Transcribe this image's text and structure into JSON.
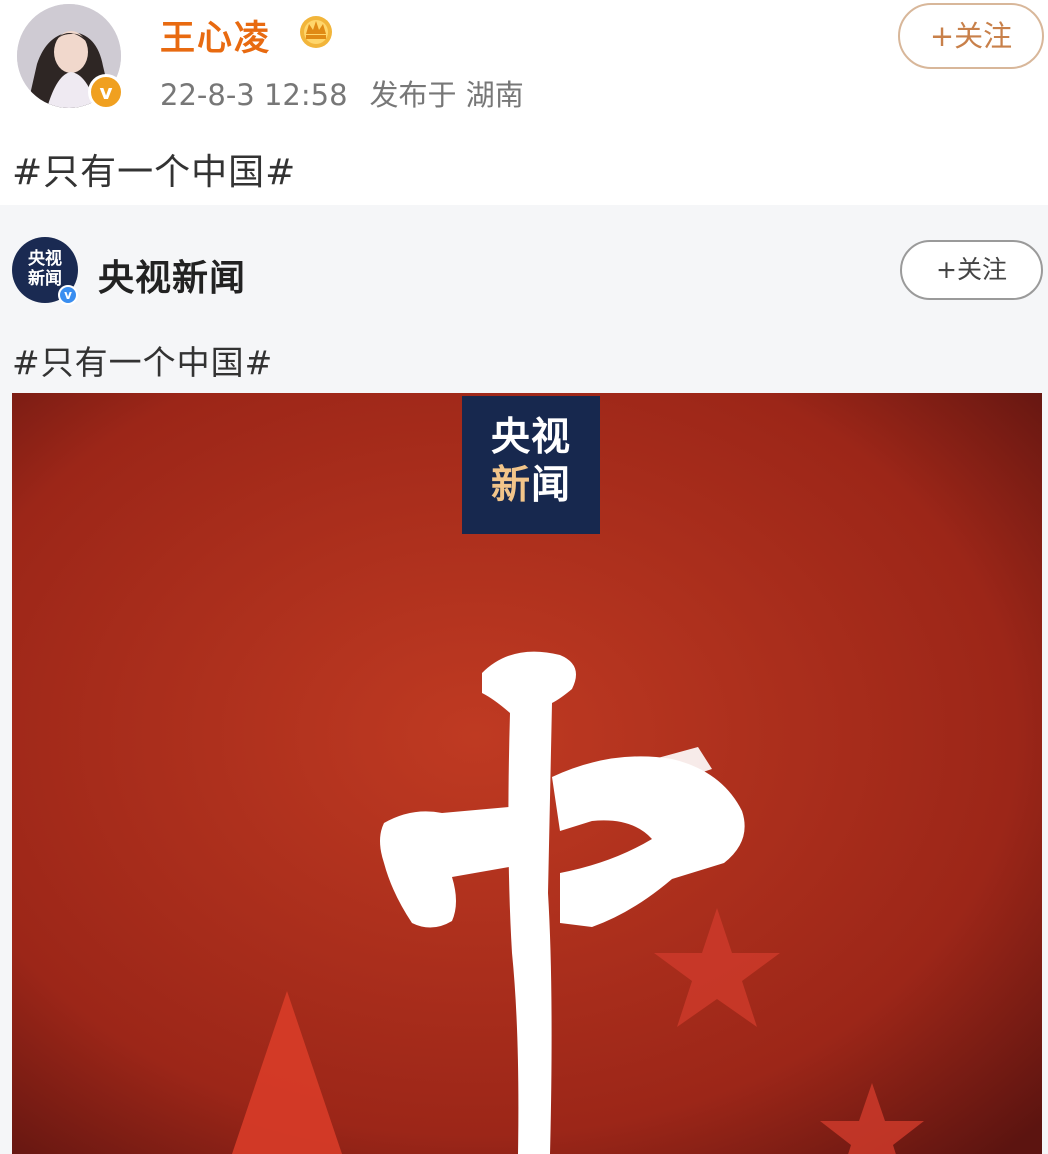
{
  "post": {
    "author": "王心凌",
    "timestamp": "22-8-3 12:58",
    "location": "发布于 湖南",
    "follow_label": "+关注",
    "text": "#只有一个中国#",
    "badge_letter": "v"
  },
  "repost": {
    "author": "央视新闻",
    "avatar_text_line1": "央视",
    "avatar_text_line2": "新闻",
    "follow_label": "+关注",
    "text": "#只有一个中国#",
    "image": {
      "logo_line1": "央视",
      "logo_line2a": "新",
      "logo_line2b": "闻",
      "calligraphy_char": "中"
    }
  },
  "colors": {
    "username": "#e86a10",
    "poster_red": "#a82a1c",
    "logo_navy": "#17284e"
  },
  "icons": [
    "crown-icon",
    "verified-badge-icon",
    "plus-icon"
  ]
}
